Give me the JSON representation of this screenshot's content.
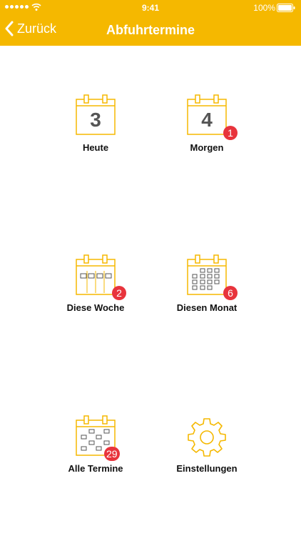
{
  "status_bar": {
    "time": "9:41",
    "battery": "100%",
    "signal_icon": "signal-dots-icon",
    "wifi_icon": "wifi-icon",
    "battery_icon": "battery-icon"
  },
  "nav": {
    "back_label": "Zurück",
    "back_icon": "chevron-left-icon",
    "title": "Abfuhrtermine"
  },
  "colors": {
    "accent": "#F5B800",
    "badge": "#E8343C",
    "icon_stroke": "#F5B800"
  },
  "tiles": [
    {
      "label": "Heute",
      "icon": "calendar-day-icon",
      "day": "3",
      "badge": ""
    },
    {
      "label": "Morgen",
      "icon": "calendar-day-icon",
      "day": "4",
      "badge": "1"
    },
    {
      "label": "Diese Woche",
      "icon": "calendar-week-icon",
      "badge": "2"
    },
    {
      "label": "Diesen Monat",
      "icon": "calendar-month-icon",
      "badge": "6"
    },
    {
      "label": "Alle Termine",
      "icon": "calendar-all-icon",
      "badge": "29"
    },
    {
      "label": "Einstellungen",
      "icon": "gear-icon",
      "badge": ""
    }
  ]
}
